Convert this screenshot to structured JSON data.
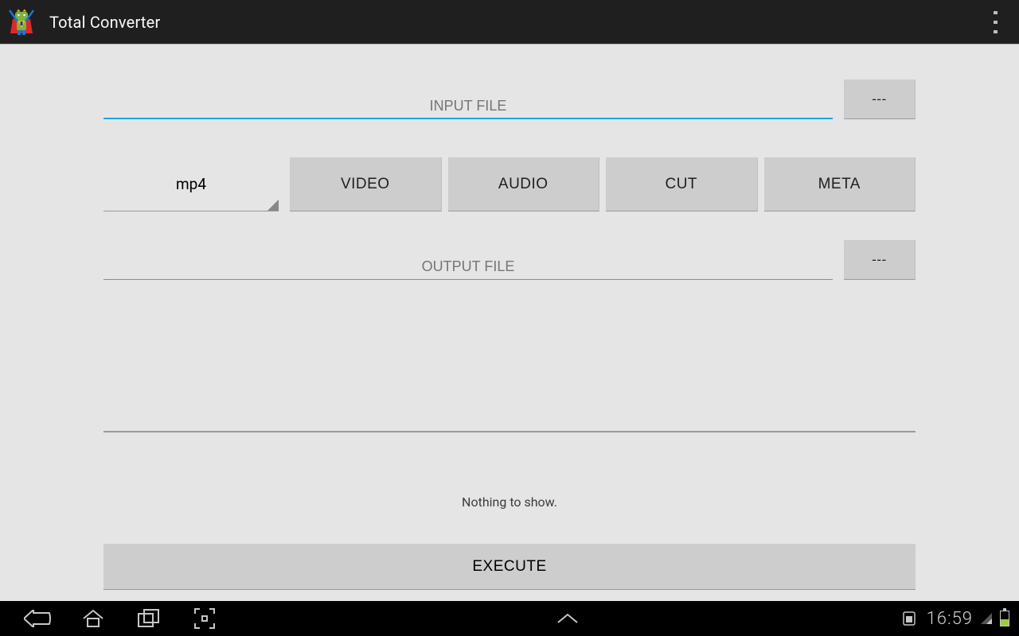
{
  "actionbar": {
    "title": "Total Converter"
  },
  "fields": {
    "input_placeholder": "INPUT FILE",
    "input_value": "",
    "output_placeholder": "OUTPUT FILE",
    "output_value": ""
  },
  "browse_label": "---",
  "spinner": {
    "selected": "mp4"
  },
  "options": {
    "video": "VIDEO",
    "audio": "AUDIO",
    "cut": "CUT",
    "meta": "META"
  },
  "status_text": "Nothing to show.",
  "execute_label": "EXECUTE",
  "system": {
    "clock": "16:59"
  }
}
